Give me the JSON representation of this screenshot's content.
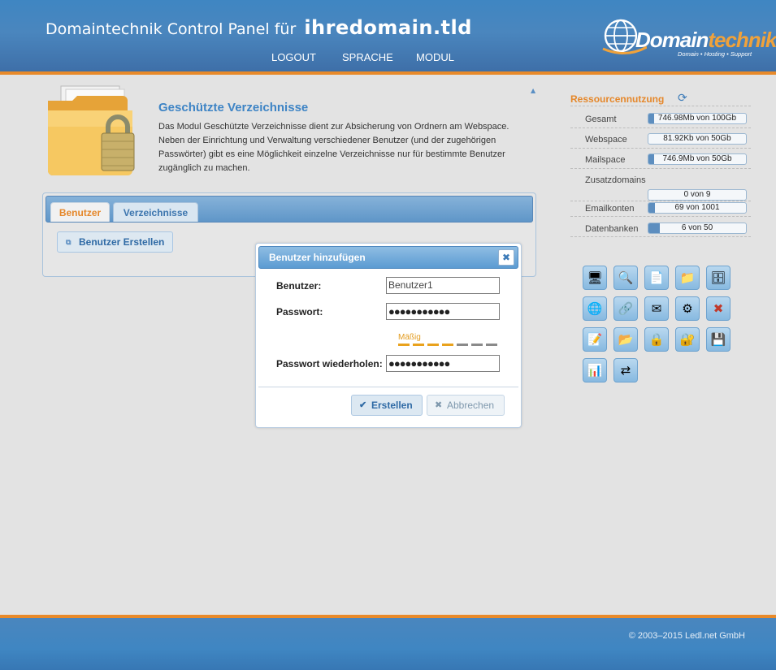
{
  "header": {
    "title_prefix": "Domaintechnik Control Panel für",
    "domain": "ihredomain.tld",
    "nav": [
      {
        "label": "LOGOUT"
      },
      {
        "label": "SPRACHE"
      },
      {
        "label": "MODUL"
      }
    ],
    "logo": {
      "name_part1": "Domain",
      "name_part2": "technik",
      "tagline": "Domain • Hosting • Support"
    }
  },
  "module": {
    "title": "Geschützte Verzeichnisse",
    "description": "Das Modul Geschützte Verzeichnisse dient zur Absicherung von Ordnern am Webspace. Neben der Einrichtung und Verwaltung verschiedener Benutzer (und der zugehörigen Passwörter) gibt es eine Möglichkeit einzelne Verzeichnisse nur für bestimmte Benutzer zugänglich zu machen.",
    "tabs": [
      {
        "label": "Benutzer",
        "active": true
      },
      {
        "label": "Verzeichnisse",
        "active": false
      }
    ],
    "create_button": "Benutzer Erstellen"
  },
  "dialog": {
    "title": "Benutzer hinzufügen",
    "close_icon": "close-icon",
    "fields": {
      "user_label": "Benutzer:",
      "user_value": "Benutzer1",
      "password_label": "Passwort:",
      "password_value": "●●●●●●●●●●●",
      "strength_label": "Mäßig",
      "strength_level": 4,
      "strength_max": 7,
      "repeat_label": "Passwort wiederholen:",
      "repeat_value": "●●●●●●●●●●●"
    },
    "ok_label": "Erstellen",
    "cancel_label": "Abbrechen"
  },
  "resources": {
    "title": "Ressourcennutzung",
    "items": [
      {
        "label": "Gesamt",
        "value": "746.98Mb von 100Gb",
        "fill": 0.01
      },
      {
        "label": "Webspace",
        "value": "81.92Kb von 50Gb",
        "fill": 0.0
      },
      {
        "label": "Mailspace",
        "value": "746.9Mb von 50Gb",
        "fill": 0.015
      },
      {
        "label": "Zusatzdomains",
        "value": "0 von 9",
        "fill": 0.0
      },
      {
        "label": "Emailkonten",
        "value": "69 von 1001",
        "fill": 0.07
      },
      {
        "label": "Datenbanken",
        "value": "6 von 50",
        "fill": 0.12
      }
    ]
  },
  "module_icons": [
    "computer-icon",
    "search-icon",
    "document-icon",
    "folder-icon",
    "database-icon",
    "globe-icon",
    "network-icon",
    "mail-icon",
    "mail-settings-icon",
    "tools-icon",
    "notes-icon",
    "folder-settings-icon",
    "folder-lock-icon",
    "lock-icon",
    "server-icon",
    "statistics-icon",
    "transfer-icon"
  ],
  "footer": {
    "copyright": "© 2003–2015 Ledl.net GmbH"
  },
  "colors": {
    "header_blue": "#4a86be",
    "accent_orange": "#e88a2a",
    "link_blue": "#3e84c5"
  }
}
